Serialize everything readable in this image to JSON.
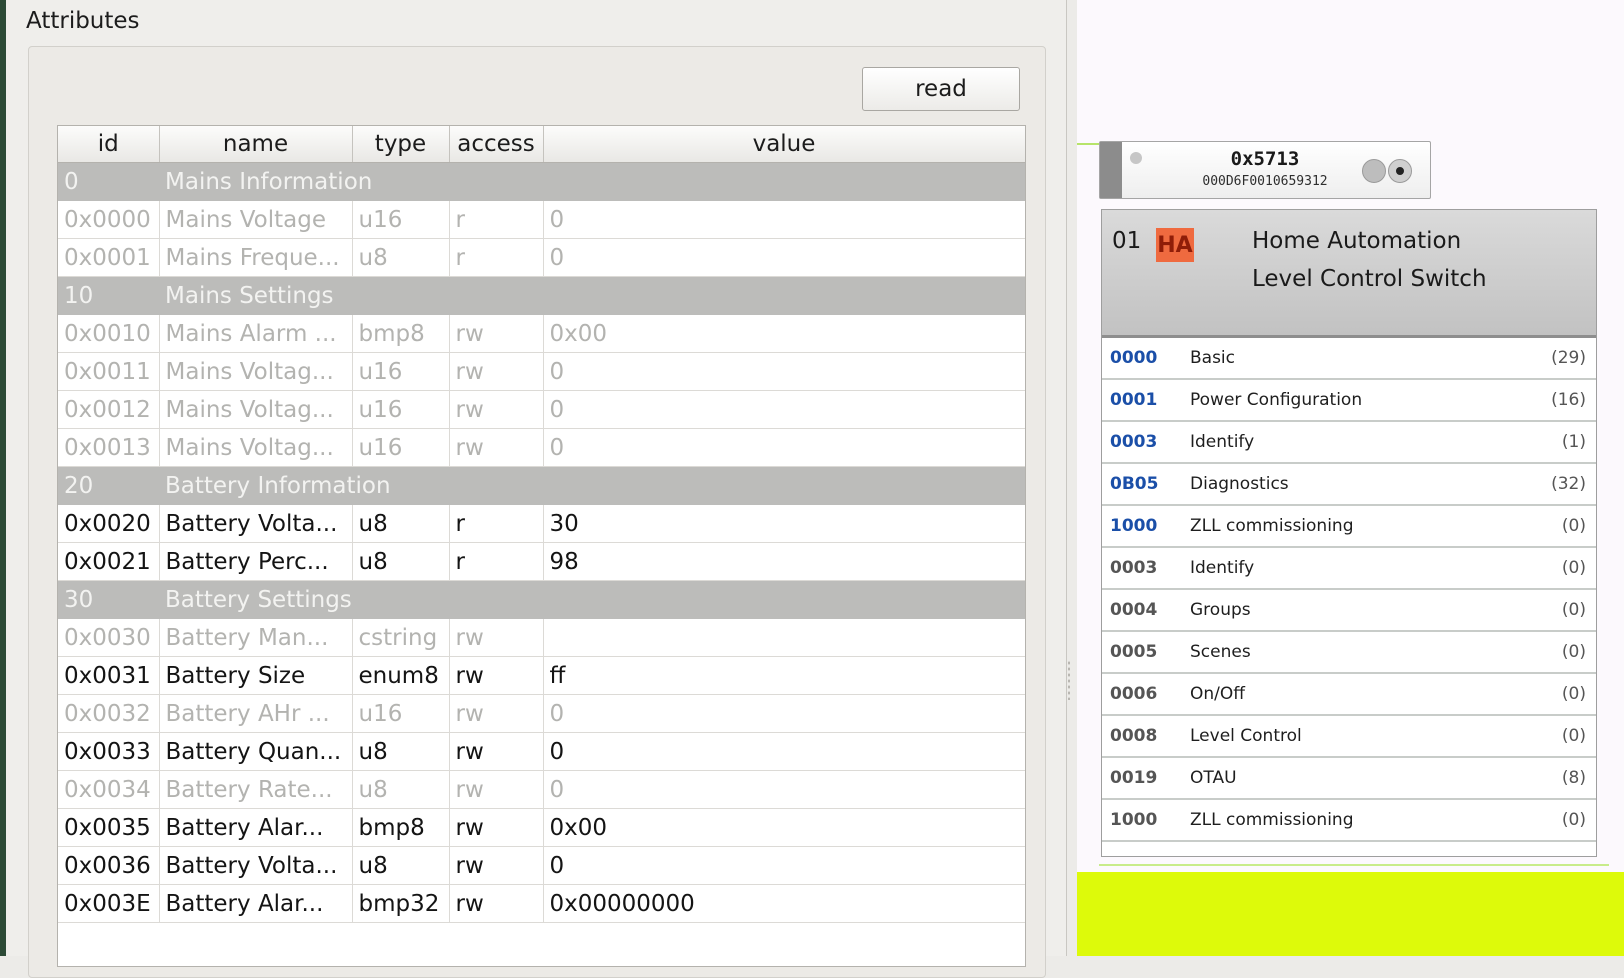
{
  "panel": {
    "title": "Attributes",
    "read_label": "read"
  },
  "table": {
    "headers": [
      "id",
      "name",
      "type",
      "access",
      "value"
    ],
    "rows": [
      {
        "kind": "group",
        "id": "0",
        "name": "Mains Information"
      },
      {
        "kind": "attr",
        "enabled": false,
        "id": "0x0000",
        "name": "Mains Voltage",
        "type": "u16",
        "access": "r",
        "value": "0"
      },
      {
        "kind": "attr",
        "enabled": false,
        "id": "0x0001",
        "name": "Mains Freque...",
        "type": "u8",
        "access": "r",
        "value": "0"
      },
      {
        "kind": "group",
        "id": "10",
        "name": "Mains Settings"
      },
      {
        "kind": "attr",
        "enabled": false,
        "id": "0x0010",
        "name": "Mains Alarm ...",
        "type": "bmp8",
        "access": "rw",
        "value": "0x00"
      },
      {
        "kind": "attr",
        "enabled": false,
        "id": "0x0011",
        "name": "Mains Voltag...",
        "type": "u16",
        "access": "rw",
        "value": "0"
      },
      {
        "kind": "attr",
        "enabled": false,
        "id": "0x0012",
        "name": "Mains Voltag...",
        "type": "u16",
        "access": "rw",
        "value": "0"
      },
      {
        "kind": "attr",
        "enabled": false,
        "id": "0x0013",
        "name": "Mains Voltag...",
        "type": "u16",
        "access": "rw",
        "value": "0"
      },
      {
        "kind": "group",
        "id": "20",
        "name": "Battery Information"
      },
      {
        "kind": "attr",
        "enabled": true,
        "id": "0x0020",
        "name": "Battery Volta...",
        "type": "u8",
        "access": "r",
        "value": "30"
      },
      {
        "kind": "attr",
        "enabled": true,
        "id": "0x0021",
        "name": "Battery Perc...",
        "type": "u8",
        "access": "r",
        "value": "98"
      },
      {
        "kind": "group",
        "id": "30",
        "name": "Battery Settings"
      },
      {
        "kind": "attr",
        "enabled": false,
        "id": "0x0030",
        "name": "Battery Man...",
        "type": "cstring",
        "access": "rw",
        "value": ""
      },
      {
        "kind": "attr",
        "enabled": true,
        "id": "0x0031",
        "name": "Battery Size",
        "type": "enum8",
        "access": "rw",
        "value": "ff"
      },
      {
        "kind": "attr",
        "enabled": false,
        "id": "0x0032",
        "name": "Battery AHr ...",
        "type": "u16",
        "access": "rw",
        "value": "0"
      },
      {
        "kind": "attr",
        "enabled": true,
        "id": "0x0033",
        "name": "Battery Quan...",
        "type": "u8",
        "access": "rw",
        "value": "0"
      },
      {
        "kind": "attr",
        "enabled": false,
        "id": "0x0034",
        "name": "Battery Rate...",
        "type": "u8",
        "access": "rw",
        "value": "0"
      },
      {
        "kind": "attr",
        "enabled": true,
        "id": "0x0035",
        "name": "Battery Alar...",
        "type": "bmp8",
        "access": "rw",
        "value": "0x00"
      },
      {
        "kind": "attr",
        "enabled": true,
        "id": "0x0036",
        "name": "Battery Volta...",
        "type": "u8",
        "access": "rw",
        "value": "0"
      },
      {
        "kind": "attr",
        "enabled": true,
        "id": "0x003E",
        "name": "Battery Alar...",
        "type": "bmp32",
        "access": "rw",
        "value": "0x00000000"
      }
    ]
  },
  "node": {
    "nwk_address": "0x5713",
    "ext_address": "000D6F0010659312",
    "endpoint": {
      "number": "01",
      "profile_badge": "HA",
      "profile": "Home Automation",
      "device": "Level Control Switch",
      "clusters": [
        {
          "id": "0000",
          "name": "Basic",
          "count": "(29)",
          "side": "server"
        },
        {
          "id": "0001",
          "name": "Power Configuration",
          "count": "(16)",
          "side": "server"
        },
        {
          "id": "0003",
          "name": "Identify",
          "count": "(1)",
          "side": "server"
        },
        {
          "id": "0B05",
          "name": "Diagnostics",
          "count": "(32)",
          "side": "server"
        },
        {
          "id": "1000",
          "name": "ZLL commissioning",
          "count": "(0)",
          "side": "server"
        },
        {
          "id": "0003",
          "name": "Identify",
          "count": "(0)",
          "side": "client"
        },
        {
          "id": "0004",
          "name": "Groups",
          "count": "(0)",
          "side": "client"
        },
        {
          "id": "0005",
          "name": "Scenes",
          "count": "(0)",
          "side": "client"
        },
        {
          "id": "0006",
          "name": "On/Off",
          "count": "(0)",
          "side": "client"
        },
        {
          "id": "0008",
          "name": "Level Control",
          "count": "(0)",
          "side": "client"
        },
        {
          "id": "0019",
          "name": "OTAU",
          "count": "(8)",
          "side": "client"
        },
        {
          "id": "1000",
          "name": "ZLL commissioning",
          "count": "(0)",
          "side": "client"
        }
      ]
    }
  },
  "colors": {
    "server_cluster": "#1b4fa8",
    "client_cluster": "#555555",
    "badge": "#ef6a3f",
    "highlight": "#ddfa0a"
  }
}
